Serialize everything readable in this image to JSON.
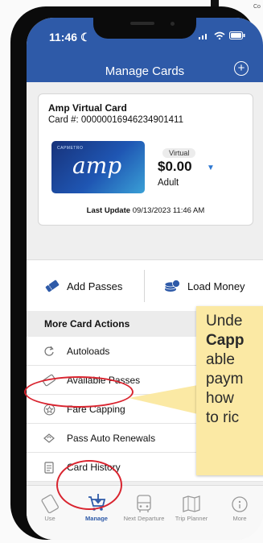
{
  "status_bar": {
    "time": "11:46",
    "moon": "☾"
  },
  "header": {
    "title": "Manage Cards",
    "add_icon": "+"
  },
  "card": {
    "name": "Amp Virtual Card",
    "number": "Card #: 00000016946234901411",
    "image_brand": "CAPMETRO",
    "image_logo": "amp",
    "badge": "Virtual",
    "balance": "$0.00",
    "fare_type": "Adult",
    "last_update_label": "Last Update",
    "last_update_value": "09/13/2023 11:46 AM"
  },
  "actions": {
    "add_passes": "Add Passes",
    "load_money": "Load Money"
  },
  "more_actions": {
    "header": "More Card Actions",
    "items": [
      "Autoloads",
      "Available Passes",
      "Fare Capping",
      "Pass Auto Renewals",
      "Card History"
    ]
  },
  "tabbar": {
    "tabs": [
      "Use",
      "Manage",
      "Next Departure",
      "Trip Planner",
      "More"
    ],
    "active": "Manage"
  },
  "callout": {
    "line1": "Unde",
    "line2": "Capp",
    "line3": "able",
    "line4": "paym",
    "line5": "how",
    "line6": "to ric"
  },
  "colors": {
    "brand_blue": "#2e5aa8",
    "highlight_red": "#d9242f",
    "callout_yellow": "#fbe9a4"
  }
}
